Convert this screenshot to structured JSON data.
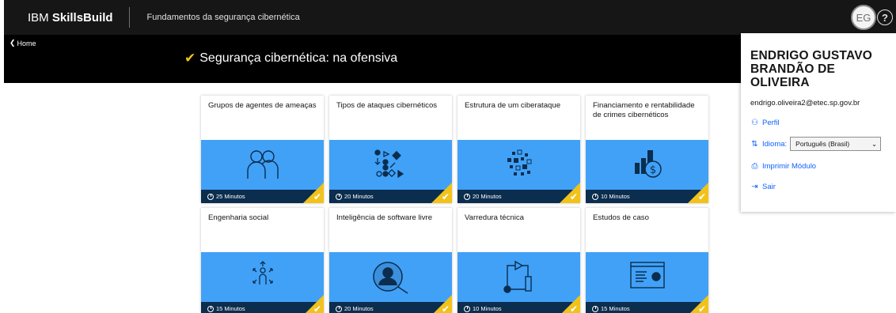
{
  "header": {
    "brand_prefix": "IBM ",
    "brand_name": "SkillsBuild",
    "course_title": "Fundamentos da segurança cibernética",
    "avatar_initials": "EG",
    "help_symbol": "?"
  },
  "banner": {
    "home_label": "Home",
    "title": "Segurança cibernética: na ofensiva",
    "check_color": "#f1c21b"
  },
  "modules": [
    {
      "title": "Grupos de agentes de ameaças",
      "duration": "25 Minutos",
      "icon": "people-icon"
    },
    {
      "title": "Tipos de ataques cibernéticos",
      "duration": "20 Minutos",
      "icon": "attack-shapes-icon"
    },
    {
      "title": "Estrutura de um ciberataque",
      "duration": "20 Minutos",
      "icon": "scattered-blocks-icon"
    },
    {
      "title": "Financiamento e rentabilidade de crimes cibernéticos",
      "duration": "10 Minutos",
      "icon": "money-chart-icon"
    },
    {
      "title": "Engenharia social",
      "duration": "15 Minutos",
      "icon": "person-arrows-icon"
    },
    {
      "title": "Inteligência de software livre",
      "duration": "20 Minutos",
      "icon": "person-search-icon"
    },
    {
      "title": "Varredura técnica",
      "duration": "10 Minutos",
      "icon": "flow-scan-icon"
    },
    {
      "title": "Estudos de caso",
      "duration": "15 Minutos",
      "icon": "document-window-icon"
    }
  ],
  "profile": {
    "name": "ENDRIGO GUSTAVO BRANDÃO DE OLIVEIRA",
    "email": "endrigo.oliveira2@etec.sp.gov.br",
    "profile_label": "Perfil",
    "language_label": "Idioma:",
    "language_value": "Português (Brasil)",
    "print_label": "Imprimir Módulo",
    "exit_label": "Sair"
  },
  "colors": {
    "card_image": "#41a1f7",
    "card_footer": "#0b2d4e",
    "complete": "#f1c21b",
    "link": "#0f62fe"
  }
}
